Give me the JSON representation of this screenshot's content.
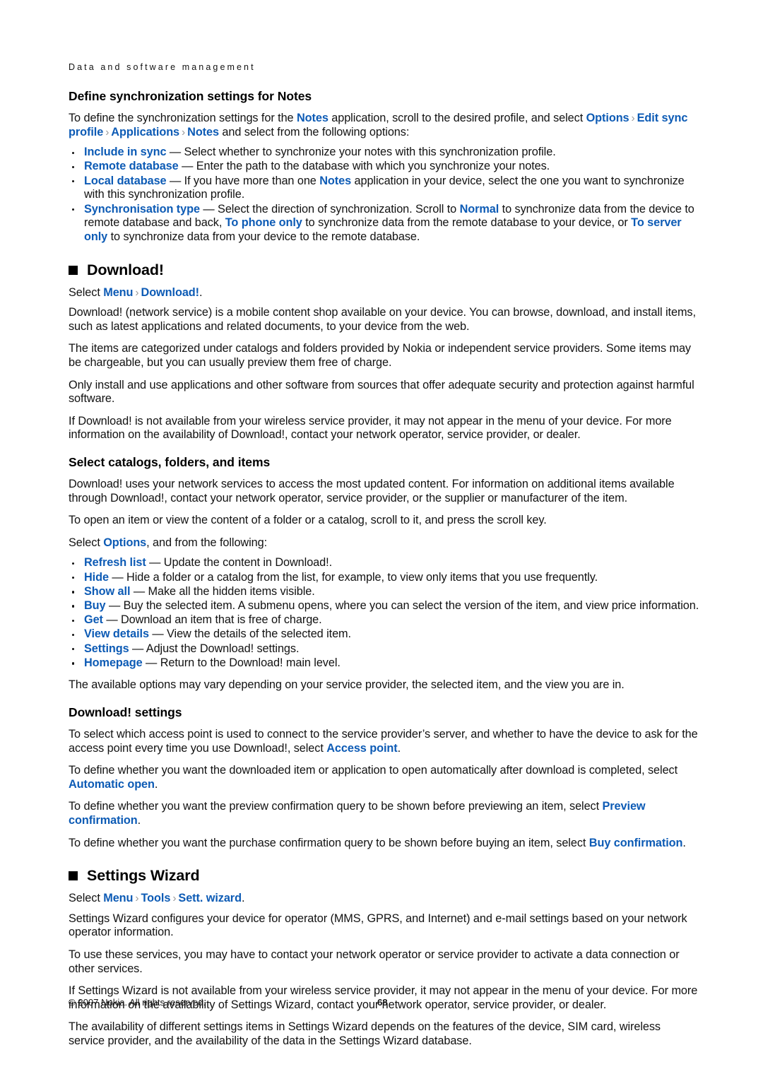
{
  "page": {
    "running_header": "Data and software management",
    "page_number": "68",
    "copyright": "© 2007 Nokia. All rights reserved.",
    "accent_color": "#0D5BB5",
    "separator_glyph": "›"
  },
  "section_notes_sync": {
    "heading": "Define synchronization settings for Notes",
    "intro": {
      "t1": "To define the synchronization settings for the ",
      "ui1": "Notes",
      "t2": " application, scroll to the desired profile, and select ",
      "ui2": "Options",
      "ui3": "Edit sync profile",
      "ui4": "Applications",
      "ui5": "Notes",
      "t3": " and select from the following options:"
    },
    "options": [
      {
        "term": "Include in sync",
        "desc": " — Select whether to synchronize your notes with this synchronization profile."
      },
      {
        "term": "Remote database",
        "desc": " — Enter the path to the database with which you synchronize your notes."
      },
      {
        "term": "Local database",
        "desc_a": " — If you have more than one ",
        "inline_ui": "Notes",
        "desc_b": " application in your device, select the one you want to synchronize with this synchronization profile."
      },
      {
        "term": "Synchronisation type",
        "desc_a": " — Select the direction of synchronization. Scroll to ",
        "ui_normal": "Normal",
        "desc_b": " to synchronize data from the device to remote database and back, ",
        "ui_phone": "To phone only",
        "desc_c": " to synchronize data from the remote database to your device, or ",
        "ui_server": "To server only",
        "desc_d": " to synchronize data from your device to the remote database."
      }
    ]
  },
  "section_download": {
    "heading": "Download!",
    "select_line": {
      "prefix": "Select ",
      "ui1": "Menu",
      "ui2": "Download!",
      "suffix": "."
    },
    "paragraphs": [
      "Download! (network service) is a mobile content shop available on your device. You can browse, download, and install items, such as latest applications and related documents, to your device from the web.",
      "The items are categorized under catalogs and folders provided by Nokia or independent service providers. Some items may be chargeable, but you can usually preview them free of charge.",
      "Only install and use applications and other software from sources that offer adequate security and protection against harmful software.",
      "If Download! is not available from your wireless service provider, it may not appear in the menu of your device. For more information on the availability of Download!, contact your network operator, service provider, or dealer."
    ]
  },
  "section_catalogs": {
    "heading": "Select catalogs, folders, and items",
    "paragraphs": [
      "Download! uses your network services to access the most updated content. For information on additional items available through Download!, contact your network operator, service provider, or the supplier or manufacturer of the item.",
      "To open an item or view the content of a folder or a catalog, scroll to it, and press the scroll key."
    ],
    "select_options_line": {
      "prefix": "Select ",
      "ui": "Options",
      "suffix": ", and from the following:"
    },
    "options": [
      {
        "term": "Refresh list",
        "desc": " — Update the content in Download!."
      },
      {
        "term": "Hide",
        "desc": " — Hide a folder or a catalog from the list, for example, to view only items that you use frequently."
      },
      {
        "term": "Show all",
        "desc": " — Make all the hidden items visible."
      },
      {
        "term": "Buy",
        "desc": " — Buy the selected item. A submenu opens, where you can select the version of the item, and view price information."
      },
      {
        "term": "Get",
        "desc": " — Download an item that is free of charge."
      },
      {
        "term": "View details",
        "desc": " — View the details of the selected item."
      },
      {
        "term": "Settings",
        "desc": " — Adjust the Download! settings."
      },
      {
        "term": "Homepage",
        "desc": " — Return to the Download! main level."
      }
    ],
    "closing": "The available options may vary depending on your service provider, the selected item, and the view you are in."
  },
  "section_download_settings": {
    "heading": "Download! settings",
    "para1": {
      "text_a": "To select which access point is used to connect to the service provider’s server, and whether to have the device to ask for the access point every time you use Download!, select ",
      "ui": "Access point",
      "text_b": "."
    },
    "para2": {
      "text_a": "To define whether you want the downloaded item or application to open automatically after download is completed, select ",
      "ui": "Automatic open",
      "text_b": "."
    },
    "para3": {
      "text_a": "To define whether you want the preview confirmation query to be shown before previewing an item, select ",
      "ui": "Preview confirmation",
      "text_b": "."
    },
    "para4": {
      "text_a": "To define whether you want the purchase confirmation query to be shown before buying an item, select ",
      "ui": "Buy confirmation",
      "text_b": "."
    }
  },
  "section_settings_wizard": {
    "heading": "Settings Wizard",
    "select_line": {
      "prefix": "Select ",
      "ui1": "Menu",
      "ui2": "Tools",
      "ui3": "Sett. wizard",
      "suffix": "."
    },
    "paragraphs": [
      "Settings Wizard configures your device for operator (MMS, GPRS, and Internet) and e-mail settings based on your network operator information.",
      "To use these services, you may have to contact your network operator or service provider to activate a data connection or other services.",
      "If Settings Wizard is not available from your wireless service provider, it may not appear in the menu of your device. For more information on the availability of Settings Wizard, contact your network operator, service provider, or dealer.",
      "The availability of different settings items in Settings Wizard depends on the features of the device, SIM card, wireless service provider, and the availability of the data in the Settings Wizard database."
    ]
  }
}
